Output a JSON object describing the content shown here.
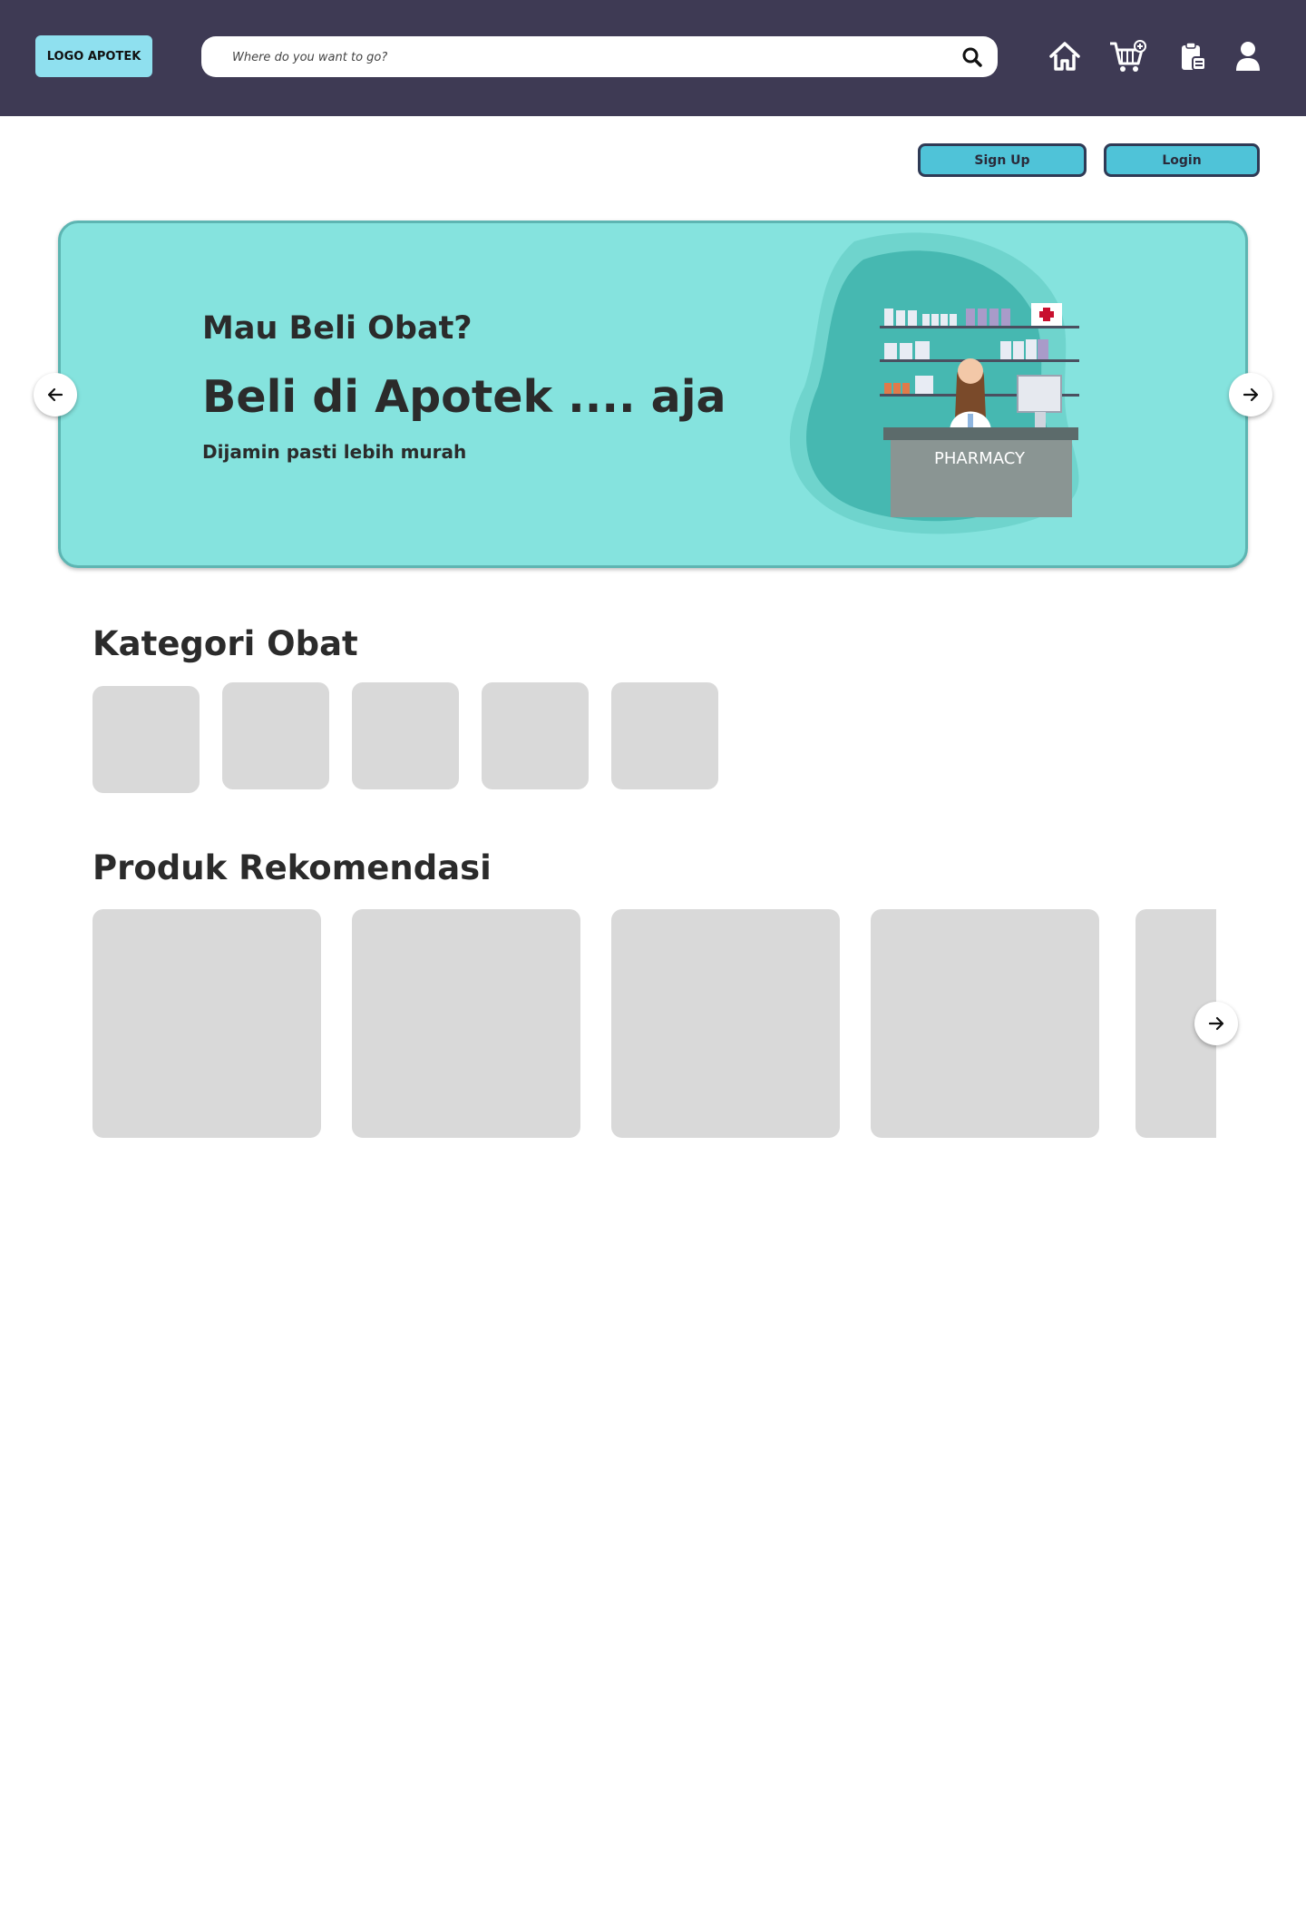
{
  "header": {
    "logo_text": "LOGO APOTEK",
    "search_placeholder": "Where do you want to go?",
    "icons": [
      "home-icon",
      "cart-add-icon",
      "clipboard-icon",
      "user-icon"
    ]
  },
  "auth": {
    "signup_label": "Sign Up",
    "login_label": "Login"
  },
  "banner": {
    "line1": "Mau Beli Obat?",
    "line2": "Beli di Apotek .... aja",
    "line3": "Dijamin pasti lebih murah",
    "illustration_sign": "PHARMACY"
  },
  "categories": {
    "title": "Kategori Obat",
    "count": 5
  },
  "products": {
    "title": "Produk Rekomendasi",
    "count": 5
  },
  "colors": {
    "topbar": "#3e3a54",
    "logo_bg": "#8fe0ef",
    "button_bg": "#4fc3d8",
    "banner_bg": "#85e3de",
    "placeholder_gray": "#d9d9d9"
  }
}
